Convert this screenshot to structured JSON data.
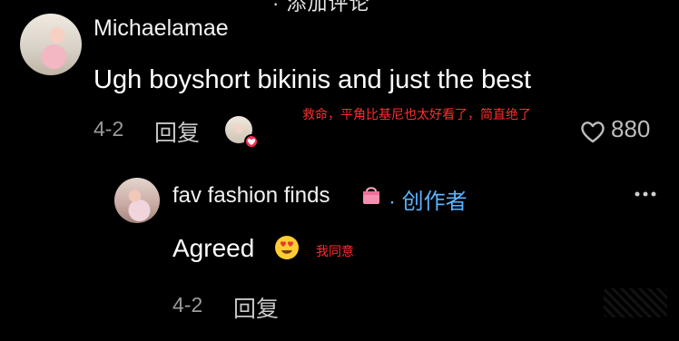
{
  "top_cut_text": "· 添加评论",
  "comment": {
    "username": "Michaelamae",
    "text": "Ugh boyshort bikinis and just the best",
    "date": "4-2",
    "reply_label": "回复",
    "likes": "880",
    "overlay_text": "救命，平角比基尼也太好看了，简直绝了"
  },
  "reply": {
    "username": "fav fashion finds",
    "creator_label": "· 创作者",
    "text": "Agreed",
    "overlay_text": "我同意",
    "date": "4-2",
    "reply_label": "回复"
  },
  "colors": {
    "accent_red": "#fe2c55",
    "overlay_red": "#ff2e2e",
    "creator_blue": "#5ab3ff",
    "muted": "#9a9a9a"
  },
  "icons": [
    "heart-icon",
    "more-options-icon",
    "shopping-bag-icon",
    "heart-eyes-emoji",
    "liked-by-creator-badge"
  ]
}
